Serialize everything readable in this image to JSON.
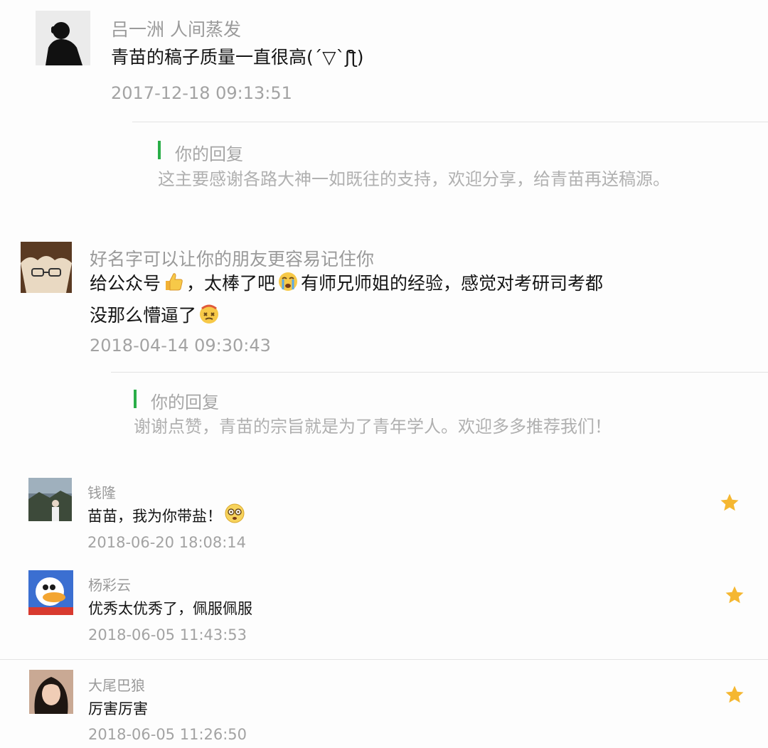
{
  "comments": [
    {
      "name": "吕一洲 人间蒸发",
      "text": "青苗的稿子质量一直很高(´▽`ʃƪ)",
      "time": "2017-12-18 09:13:51",
      "reply": {
        "title": "你的回复",
        "text": "这主要感谢各路大神一如既往的支持，欢迎分享，给青苗再送稿源。"
      }
    },
    {
      "name": "好名字可以让你的朋友更容易记住你",
      "text_parts": [
        "给公众号",
        "，太棒了吧",
        "有师兄师姐的经验，感觉对考研司考都",
        "没那么懵逼了"
      ],
      "emojis": [
        "thumbs-up-emoji",
        "crying-emoji",
        "dizzy-emoji"
      ],
      "time": "2018-04-14 09:30:43",
      "reply": {
        "title": "你的回复",
        "text": "谢谢点赞，青苗的宗旨就是为了青年学人。欢迎多多推荐我们！"
      }
    },
    {
      "name": "钱隆",
      "text": "苗苗，我为你带盐！",
      "emoji": "dazed-emoji",
      "time": "2018-06-20 18:08:14",
      "starred": true
    },
    {
      "name": "杨彩云",
      "text": "优秀太优秀了，佩服佩服",
      "time": "2018-06-05 11:43:53",
      "starred": true
    },
    {
      "name": "大尾巴狼",
      "text": "厉害厉害",
      "time": "2018-06-05 11:26:50",
      "starred": true
    }
  ],
  "colors": {
    "accent_green": "#2aae48",
    "star": "#f5b731",
    "meta_gray": "#a3a3a3"
  }
}
